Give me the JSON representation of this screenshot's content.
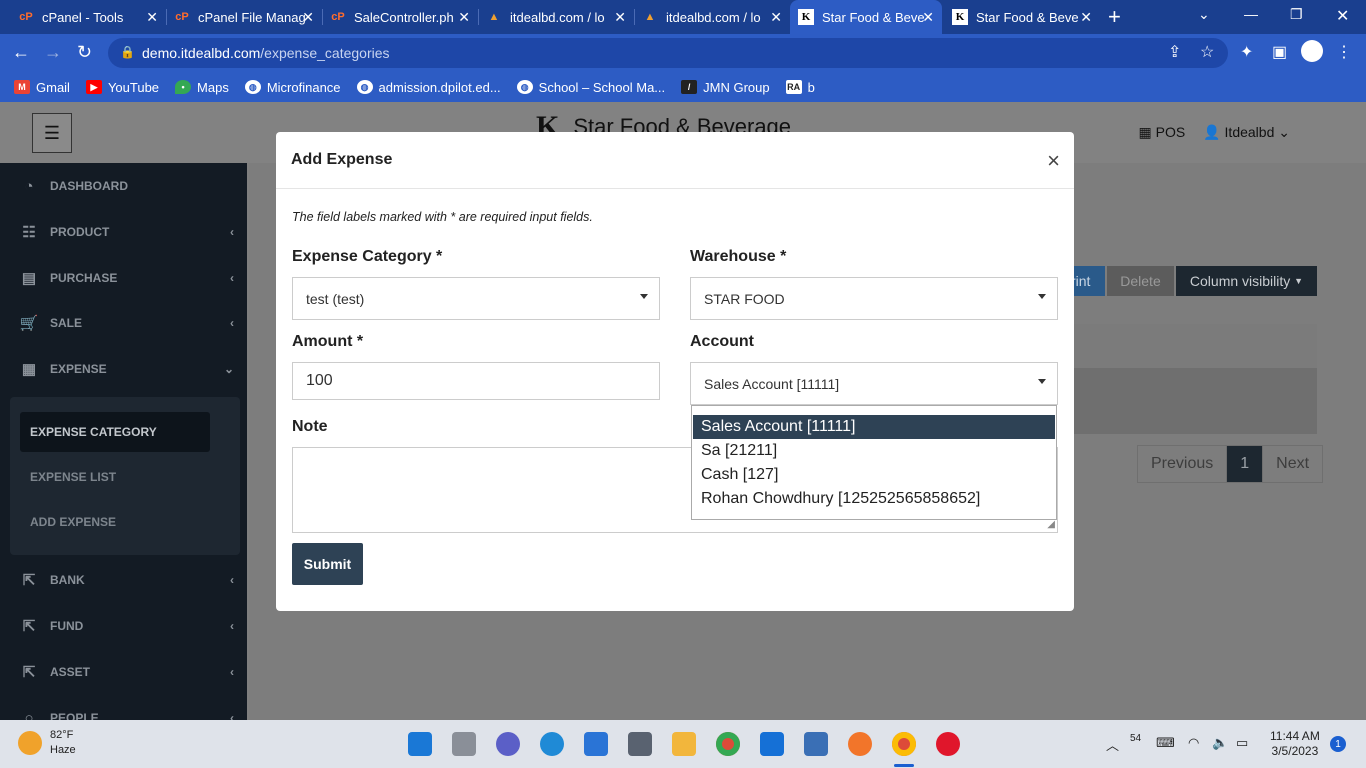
{
  "browser": {
    "tabs": [
      {
        "title": "cPanel - Tools",
        "icon": "cpanel-icon"
      },
      {
        "title": "cPanel File Manag",
        "icon": "cpanel-icon"
      },
      {
        "title": "SaleController.ph",
        "icon": "cpanel-icon"
      },
      {
        "title": "itdealbd.com / lo",
        "icon": "phpmyadmin-icon"
      },
      {
        "title": "itdealbd.com / lo",
        "icon": "phpmyadmin-icon"
      },
      {
        "title": "Star Food & Beve",
        "icon": "star-logo-icon",
        "active": true
      },
      {
        "title": "Star Food & Beve",
        "icon": "star-logo-icon"
      }
    ],
    "url_host": "demo.itdealbd.com",
    "url_path": "/expense_categories",
    "bookmarks": [
      {
        "label": "Gmail",
        "icon": "gmail-icon",
        "color": "#ea4335"
      },
      {
        "label": "YouTube",
        "icon": "youtube-icon",
        "color": "#ff0000"
      },
      {
        "label": "Maps",
        "icon": "maps-icon",
        "color": "#34a853"
      },
      {
        "label": "Microfinance",
        "icon": "globe-icon",
        "color": "#2d5cc4"
      },
      {
        "label": "admission.dpilot.ed...",
        "icon": "globe-icon",
        "color": "#2d5cc4"
      },
      {
        "label": "School – School Ma...",
        "icon": "globe-icon",
        "color": "#2d5cc4"
      },
      {
        "label": "JMN Group",
        "icon": "jmn-icon",
        "color": "#222222"
      },
      {
        "label": "b",
        "icon": "ra-icon",
        "color": "#444444"
      }
    ]
  },
  "app": {
    "brand": "Star Food & Beverage",
    "logo_text": "K",
    "pos_label": "POS",
    "user_label": "Itdealbd",
    "sidebar": [
      {
        "label": "DASHBOARD",
        "icon": "dashboard-icon"
      },
      {
        "label": "PRODUCT",
        "icon": "product-icon"
      },
      {
        "label": "PURCHASE",
        "icon": "purchase-icon"
      },
      {
        "label": "SALE",
        "icon": "cart-icon"
      },
      {
        "label": "EXPENSE",
        "icon": "calculator-icon"
      },
      {
        "label": "BANK",
        "icon": "bank-icon"
      },
      {
        "label": "FUND",
        "icon": "fund-icon"
      },
      {
        "label": "ASSET",
        "icon": "asset-icon"
      },
      {
        "label": "PEOPLE",
        "icon": "people-icon"
      }
    ],
    "expense_sub": [
      "EXPENSE CATEGORY",
      "EXPENSE LIST",
      "ADD EXPENSE"
    ],
    "buttons": {
      "print": "rint",
      "delete": "Delete",
      "column_visibility": "Column visibility"
    },
    "pagination": {
      "previous": "Previous",
      "page": "1",
      "next": "Next"
    }
  },
  "modal": {
    "title": "Add Expense",
    "close": "×",
    "required_note": "The field labels marked with * are required input fields.",
    "expense_category_label": "Expense Category *",
    "expense_category_value": "test (test)",
    "warehouse_label": "Warehouse *",
    "warehouse_value": "STAR FOOD",
    "amount_label": "Amount *",
    "amount_value": "100",
    "account_label": "Account",
    "account_value": "Sales Account [11111]",
    "account_options": [
      "Sales Account [11111]",
      "Sa [21211]",
      "Cash [127]",
      "Rohan Chowdhury [125252565858652]"
    ],
    "note_label": "Note",
    "submit": "Submit"
  },
  "taskbar": {
    "temperature": "82°F",
    "weather": "Haze",
    "time": "11:44 AM",
    "date": "3/5/2023",
    "notifications": "1",
    "tray_count": "54"
  }
}
